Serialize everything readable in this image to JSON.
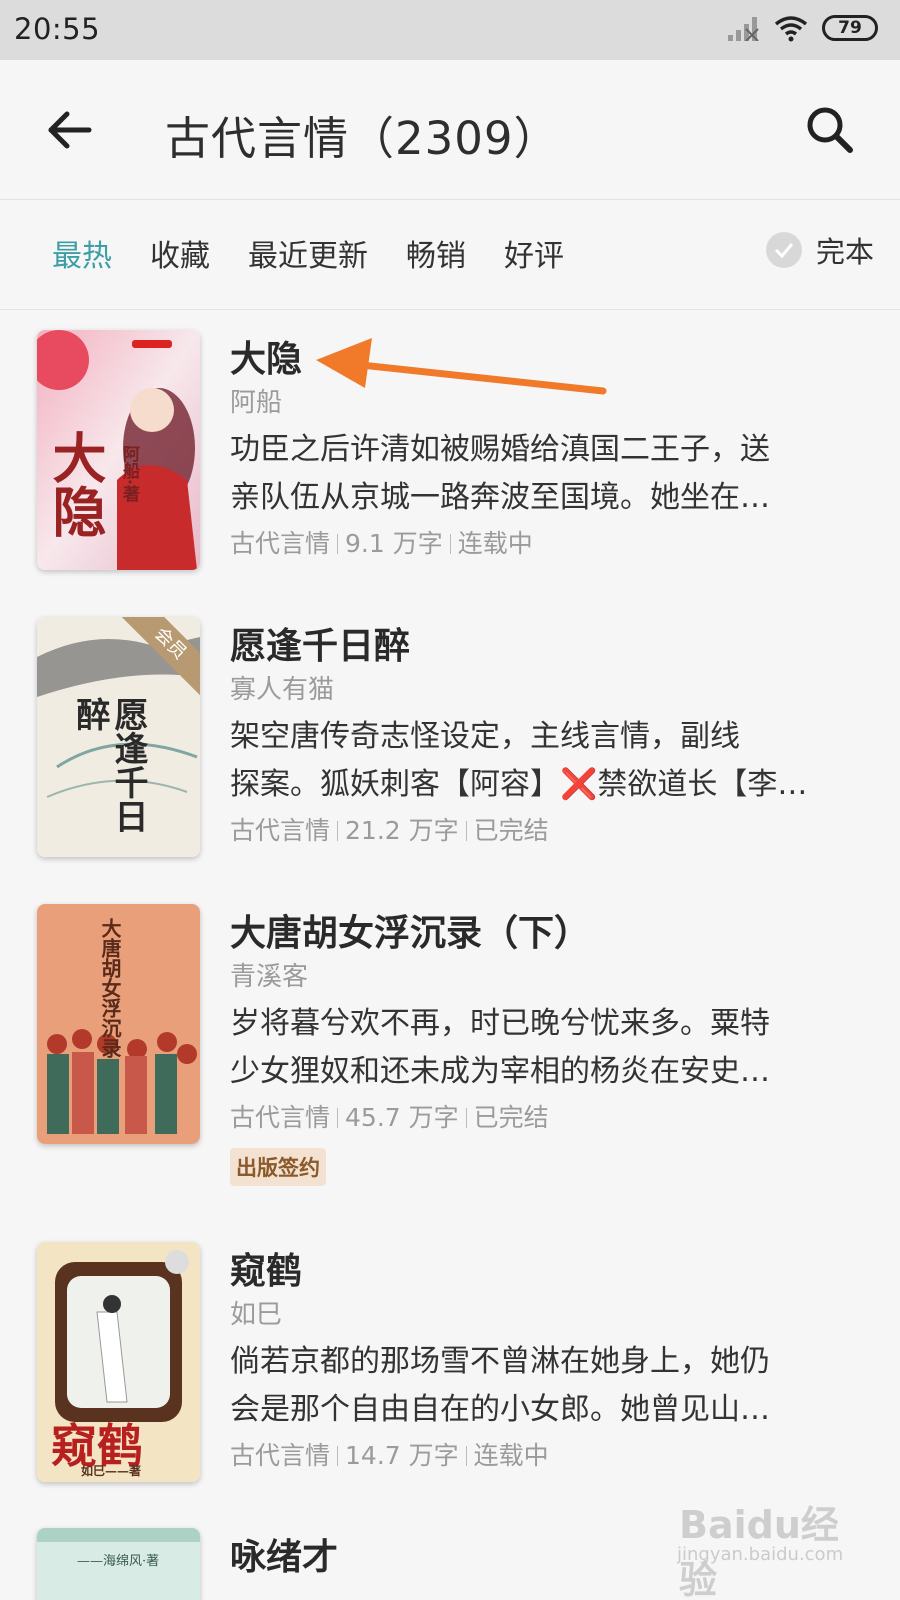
{
  "status": {
    "time": "20:55",
    "battery": "79",
    "colors": {
      "bar": "#dcdcdc"
    }
  },
  "header": {
    "title": "古代言情（2309）",
    "back_icon": "arrow-left-icon",
    "search_icon": "search-icon"
  },
  "filters": {
    "tabs": [
      "最热",
      "收藏",
      "最近更新",
      "畅销",
      "好评"
    ],
    "active_index": 0,
    "active_color": "#3d9ea6",
    "complete_label": "完本"
  },
  "books": [
    {
      "title": "大隐",
      "author": "阿船",
      "desc_line1": "功臣之后许清如被赐婚给滇国二王子，送",
      "desc_line2": "亲队伍从京城一路奔波至国境。她坐在…",
      "category": "古代言情",
      "words": "9.1 万字",
      "status": "连载中",
      "cover_text": "大隐",
      "cover_author": "阿船·著"
    },
    {
      "title": "愿逢千日醉",
      "author": "寡人有猫",
      "desc_line1": "架空唐传奇志怪设定，主线言情，副线",
      "desc_line2": "探案。狐妖刺客【阿容】❌禁欲道长【李…",
      "category": "古代言情",
      "words": "21.2 万字",
      "status": "已完结",
      "cover_text": "愿逢千日醉",
      "vip_label": "会员"
    },
    {
      "title": "大唐胡女浮沉录（下）",
      "author": "青溪客",
      "desc_line1": "岁将暮兮欢不再，时已晚兮忧来多。粟特",
      "desc_line2": "少女狸奴和还未成为宰相的杨炎在安史…",
      "category": "古代言情",
      "words": "45.7 万字",
      "status": "已完结",
      "badge": "出版签约",
      "cover_text": "大唐胡女浮沉录"
    },
    {
      "title": "窥鹤",
      "author": "如巳",
      "desc_line1": "倘若京都的那场雪不曾淋在她身上，她仍",
      "desc_line2": "会是那个自由自在的小女郎。她曾见山…",
      "category": "古代言情",
      "words": "14.7 万字",
      "status": "连载中",
      "cover_text": "窥鹤",
      "cover_author": "如巳——著"
    },
    {
      "title": "咏绪才",
      "cover_author": "——海绵风·著"
    }
  ],
  "annotation": {
    "arrow_color": "#f07a2a"
  },
  "watermark": {
    "brand": "Baidu经验",
    "url": "jingyan.baidu.com"
  }
}
